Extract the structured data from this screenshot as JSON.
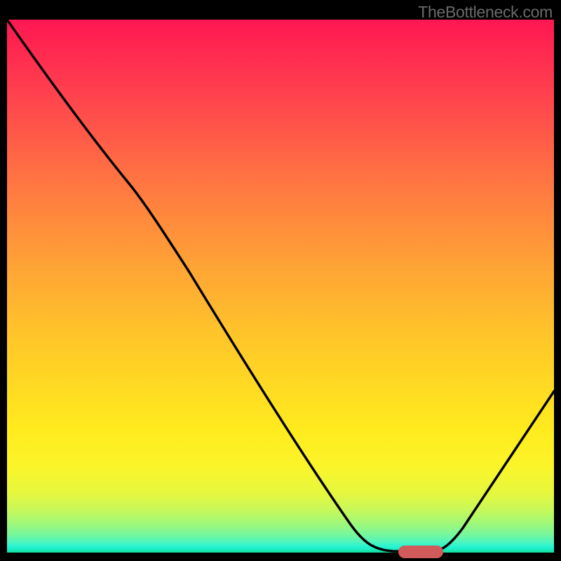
{
  "watermark": "TheBottleneck.com",
  "chart_data": {
    "type": "line",
    "title": "",
    "xlabel": "",
    "ylabel": "",
    "xlim": [
      0,
      1
    ],
    "ylim": [
      0,
      1
    ],
    "x": [
      0.0,
      0.05,
      0.1,
      0.15,
      0.2,
      0.23,
      0.28,
      0.33,
      0.38,
      0.43,
      0.48,
      0.53,
      0.58,
      0.63,
      0.67,
      0.7,
      0.73,
      0.76,
      0.8,
      0.84,
      0.88,
      0.92,
      0.96,
      1.0
    ],
    "values": [
      1.0,
      0.93,
      0.86,
      0.79,
      0.73,
      0.69,
      0.61,
      0.52,
      0.44,
      0.36,
      0.28,
      0.2,
      0.12,
      0.05,
      0.015,
      0.003,
      0.0,
      0.0,
      0.003,
      0.03,
      0.09,
      0.16,
      0.23,
      0.3
    ],
    "background_gradient": {
      "top": "#ff1751",
      "mid": "#ffc22b",
      "bottom": "#12e0a0"
    },
    "marker": {
      "x_start": 0.72,
      "x_end": 0.8,
      "y": 0.0,
      "color": "#d15a5a"
    }
  }
}
